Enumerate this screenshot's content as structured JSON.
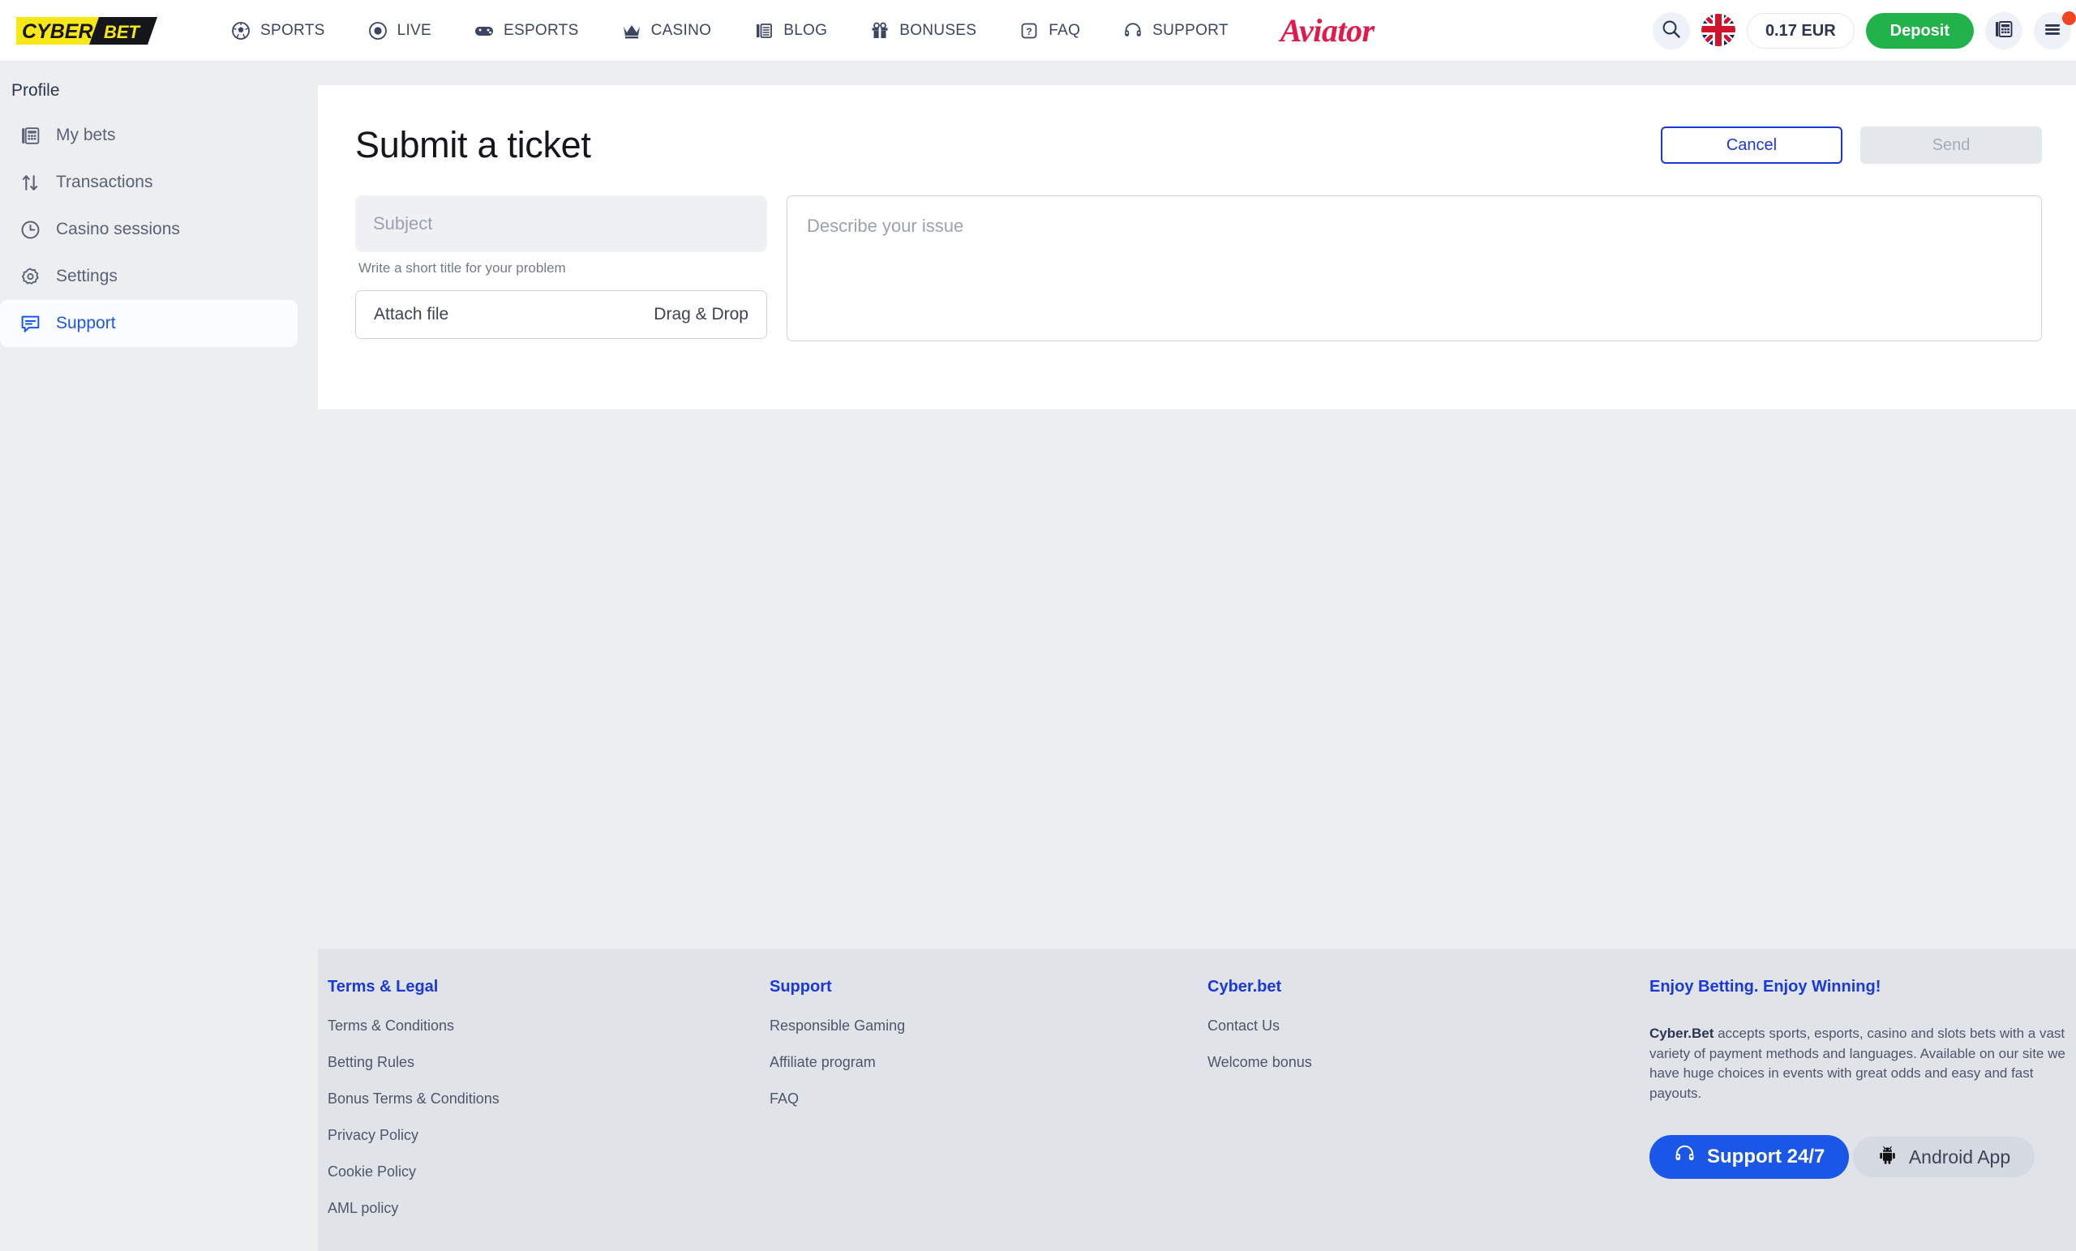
{
  "header": {
    "logo": {
      "part1": "CYBER",
      "part2": "BET"
    },
    "nav": [
      {
        "label": "SPORTS",
        "icon": "football-icon"
      },
      {
        "label": "LIVE",
        "icon": "live-dot-icon"
      },
      {
        "label": "ESPORTS",
        "icon": "gamepad-icon"
      },
      {
        "label": "CASINO",
        "icon": "crown-icon"
      },
      {
        "label": "BLOG",
        "icon": "blog-icon"
      },
      {
        "label": "BONUSES",
        "icon": "gift-icon"
      },
      {
        "label": "FAQ",
        "icon": "question-box-icon"
      },
      {
        "label": "SUPPORT",
        "icon": "headset-icon"
      }
    ],
    "aviator_label": "Aviator",
    "search_icon": "search-icon",
    "language_flag": "uk-flag-icon",
    "balance": "0.17 EUR",
    "deposit_label": "Deposit",
    "bets_icon": "bet-slip-icon",
    "menu_icon": "hamburger-menu-icon",
    "colors": {
      "deposit_green": "#21b24b",
      "aviator_red": "#e21a4b",
      "accent_blue": "#1a56e8"
    }
  },
  "sidebar": {
    "title": "Profile",
    "items": [
      {
        "label": "My bets",
        "icon": "bet-slip-icon",
        "active": false
      },
      {
        "label": "Transactions",
        "icon": "transfer-arrows-icon",
        "active": false
      },
      {
        "label": "Casino sessions",
        "icon": "clock-icon",
        "active": false
      },
      {
        "label": "Settings",
        "icon": "gear-icon",
        "active": false
      },
      {
        "label": "Support",
        "icon": "chat-bubble-icon",
        "active": true
      }
    ]
  },
  "main": {
    "title": "Submit a ticket",
    "cancel_label": "Cancel",
    "send_label": "Send",
    "subject_placeholder": "Subject",
    "subject_value": "",
    "subject_hint": "Write a short title for your problem",
    "attach_label": "Attach file",
    "attach_drag_label": "Drag & Drop",
    "issue_placeholder": "Describe your issue",
    "issue_value": ""
  },
  "footer": {
    "columns": [
      {
        "heading": "Terms & Legal",
        "links": [
          "Terms & Conditions",
          "Betting Rules",
          "Bonus Terms & Conditions",
          "Privacy Policy",
          "Cookie Policy",
          "AML policy"
        ]
      },
      {
        "heading": "Support",
        "links": [
          "Responsible Gaming",
          "Affiliate program",
          "FAQ"
        ]
      },
      {
        "heading": "Cyber.bet",
        "links": [
          "Contact Us",
          "Welcome bonus"
        ]
      }
    ],
    "promo": {
      "heading": "Enjoy Betting. Enjoy Winning!",
      "brand": "Cyber.Bet",
      "description": " accepts sports, esports, casino and slots bets with a vast variety of payment methods and languages. Available on our site we have huge choices in events with great odds and easy and fast payouts.",
      "support_button": "Support 24/7",
      "android_button": "Android App"
    }
  }
}
